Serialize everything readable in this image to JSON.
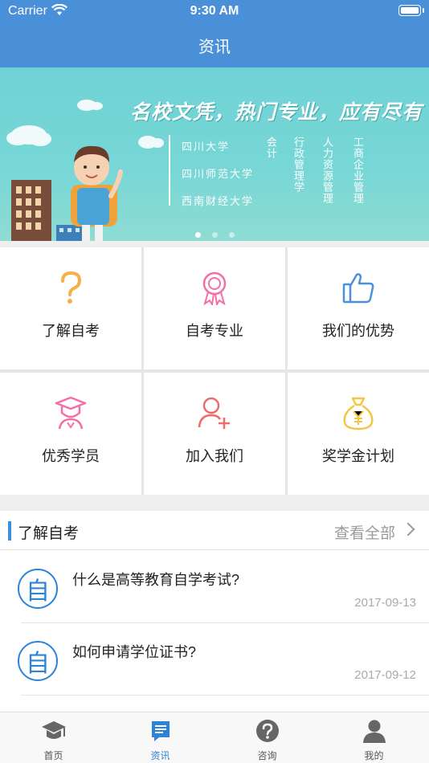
{
  "status_bar": {
    "carrier": "Carrier",
    "time": "9:30 AM"
  },
  "nav": {
    "title": "资讯"
  },
  "banner": {
    "slogan": "名校文凭，热门专业，应有尽有",
    "universities": [
      "四川大学",
      "四川师范大学",
      "西南财经大学"
    ],
    "majors": [
      "会计",
      "行政管理学",
      "人力资源管理",
      "工商企业管理"
    ],
    "page_count": 3,
    "active_page": 1
  },
  "grid": {
    "items": [
      {
        "label": "了解自考",
        "icon": "question-icon",
        "color": "#f5b04a"
      },
      {
        "label": "自考专业",
        "icon": "ribbon-badge-icon",
        "color": "#f36fa7"
      },
      {
        "label": "我们的优势",
        "icon": "thumbs-up-icon",
        "color": "#4a8fe0"
      },
      {
        "label": "优秀学员",
        "icon": "graduate-icon",
        "color": "#f36fa7"
      },
      {
        "label": "加入我们",
        "icon": "add-user-icon",
        "color": "#ee6b6b"
      },
      {
        "label": "奖学金计划",
        "icon": "money-bag-icon",
        "color": "#f5c542"
      }
    ]
  },
  "section": {
    "title": "了解自考",
    "more": "查看全部",
    "items": [
      {
        "avatar": "自",
        "question": "什么是高等教育自学考试?",
        "date": "2017-09-13"
      },
      {
        "avatar": "自",
        "question": "如何申请学位证书?",
        "date": "2017-09-12"
      }
    ]
  },
  "tabbar": {
    "tabs": [
      {
        "label": "首页",
        "icon": "graduation-cap-icon",
        "active": false
      },
      {
        "label": "资讯",
        "icon": "news-icon",
        "active": true
      },
      {
        "label": "咨询",
        "icon": "help-circle-icon",
        "active": false
      },
      {
        "label": "我的",
        "icon": "profile-icon",
        "active": false
      }
    ]
  },
  "colors": {
    "primary": "#4a90d9",
    "accent": "#2c83d8"
  }
}
